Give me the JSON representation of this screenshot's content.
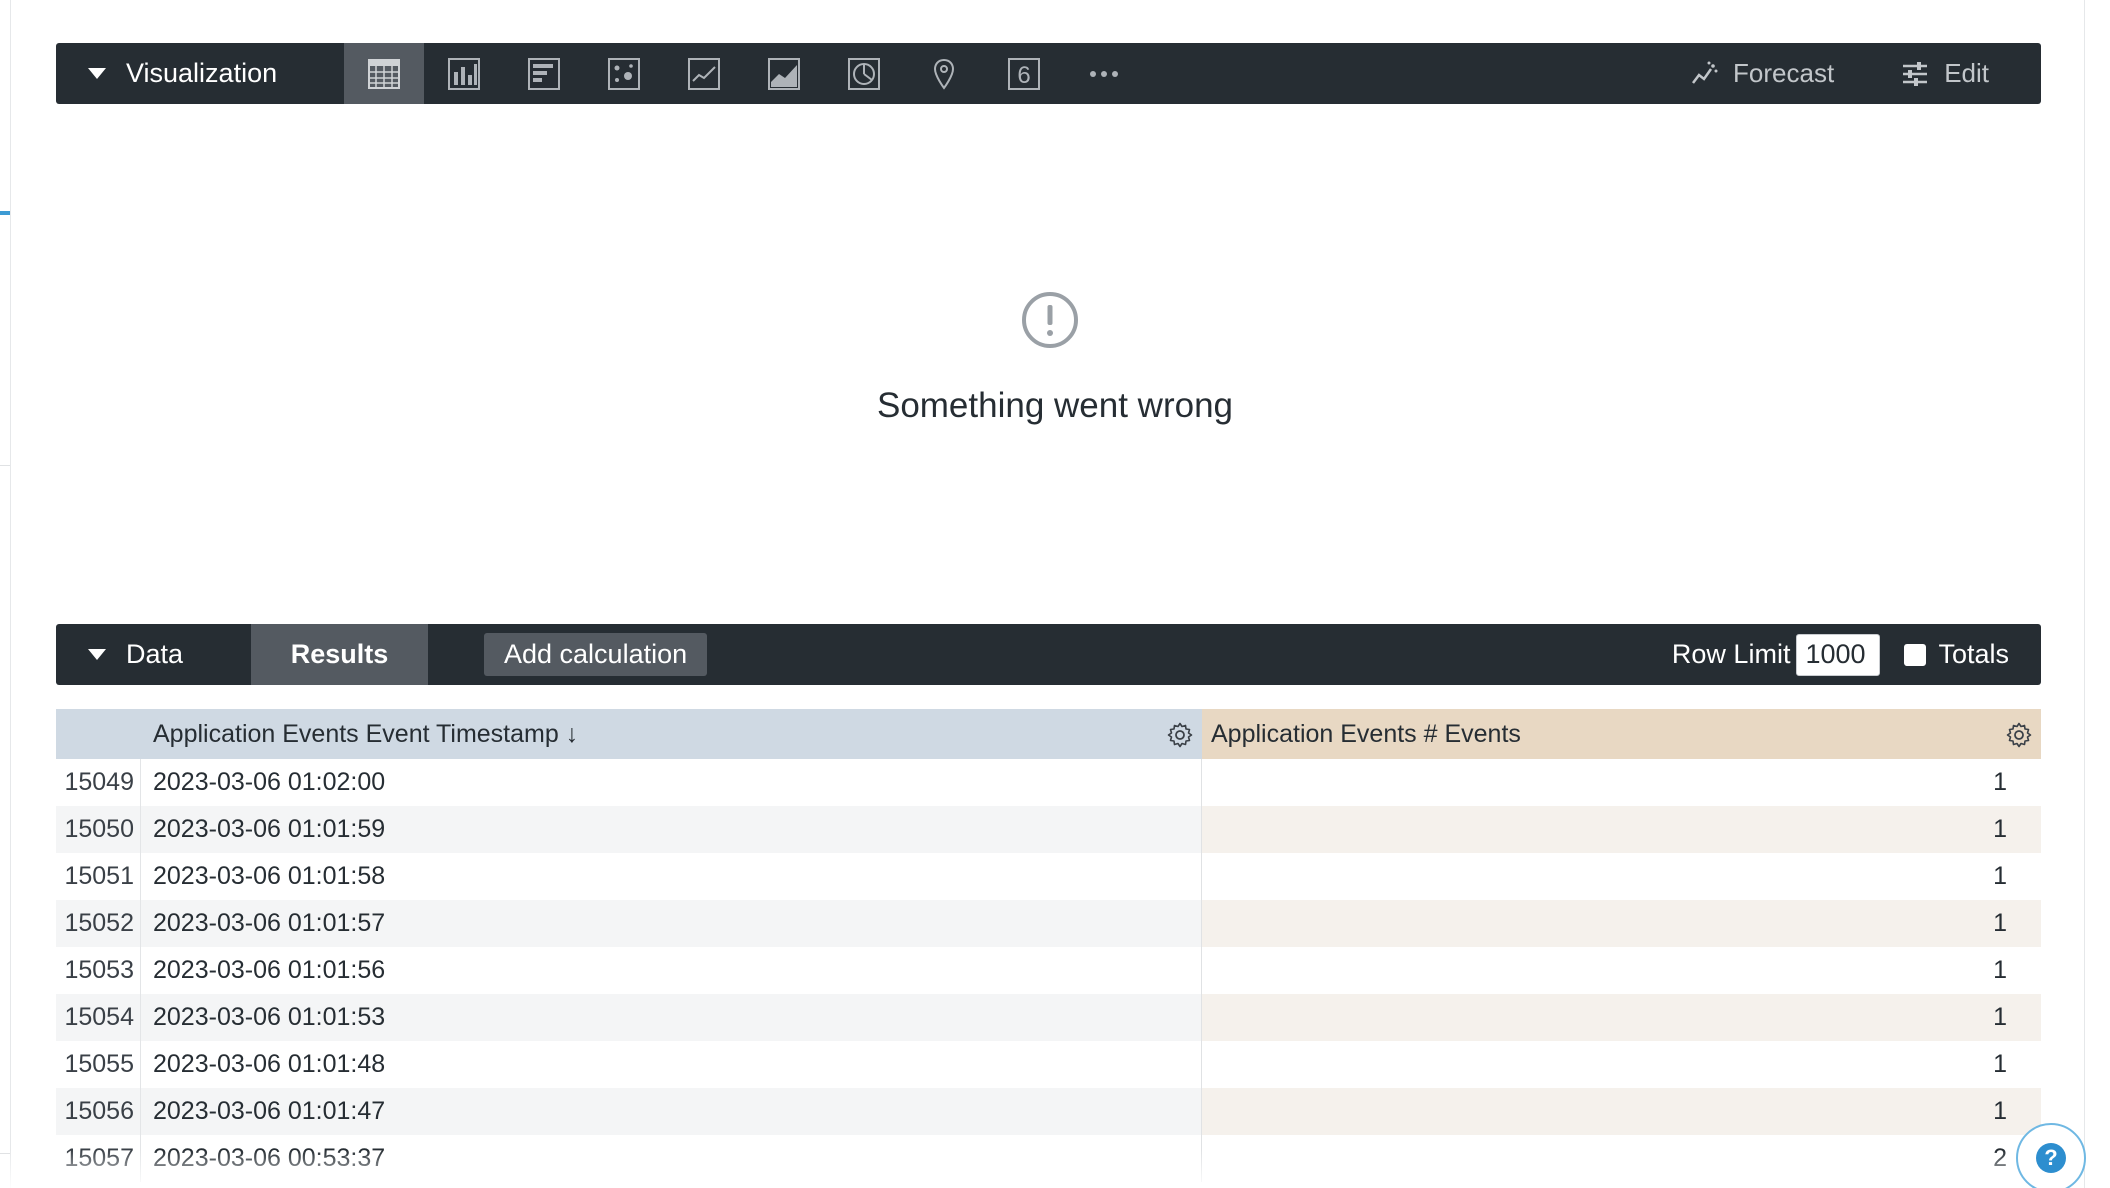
{
  "visualization": {
    "label": "Visualization",
    "icons": [
      "table-icon",
      "column-chart-icon",
      "bar-chart-icon",
      "scatter-icon",
      "line-chart-icon",
      "area-chart-icon",
      "pie-chart-icon",
      "map-pin-icon",
      "single-value-icon",
      "more-icon"
    ],
    "single_value_glyph": "6",
    "active": "table-icon",
    "forecast_label": "Forecast",
    "edit_label": "Edit"
  },
  "error": {
    "message": "Something went wrong"
  },
  "data": {
    "label": "Data",
    "results_tab": "Results",
    "add_calculation": "Add calculation",
    "row_limit_label": "Row Limit",
    "row_limit_value": "1000",
    "totals_label": "Totals"
  },
  "table": {
    "columns": [
      "Application Events Event Timestamp ↓",
      "Application Events # Events"
    ],
    "rows": [
      {
        "num": "15049",
        "ts": "2023-03-06 01:02:00",
        "events": "1"
      },
      {
        "num": "15050",
        "ts": "2023-03-06 01:01:59",
        "events": "1"
      },
      {
        "num": "15051",
        "ts": "2023-03-06 01:01:58",
        "events": "1"
      },
      {
        "num": "15052",
        "ts": "2023-03-06 01:01:57",
        "events": "1"
      },
      {
        "num": "15053",
        "ts": "2023-03-06 01:01:56",
        "events": "1"
      },
      {
        "num": "15054",
        "ts": "2023-03-06 01:01:53",
        "events": "1"
      },
      {
        "num": "15055",
        "ts": "2023-03-06 01:01:48",
        "events": "1"
      },
      {
        "num": "15056",
        "ts": "2023-03-06 01:01:47",
        "events": "1"
      },
      {
        "num": "15057",
        "ts": "2023-03-06 00:53:37",
        "events": "2"
      }
    ]
  },
  "help": {
    "glyph": "?"
  },
  "colors": {
    "bar_bg": "#262d33",
    "active_tab": "#545a61",
    "dimension_header": "#cfd9e3",
    "measure_header": "#e8d8c3",
    "help_accent": "#2d8ecf"
  }
}
